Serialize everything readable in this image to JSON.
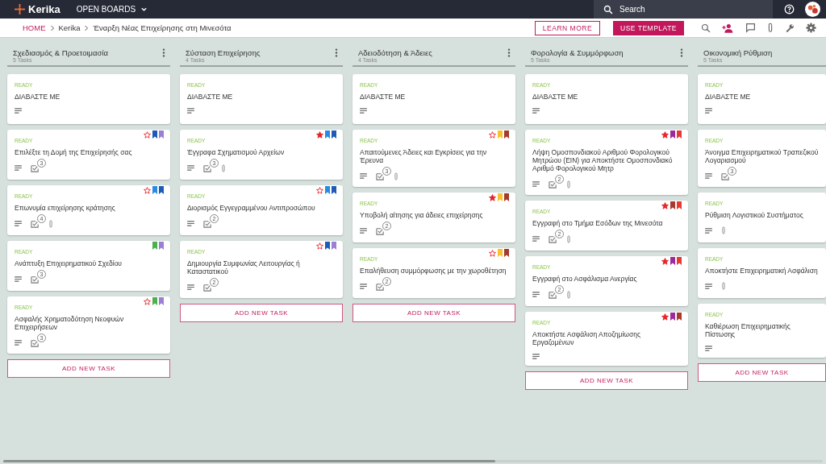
{
  "topbar": {
    "logo": "Kerika",
    "boards_menu": "OPEN BOARDS",
    "search": {
      "placeholder": "Search"
    }
  },
  "breadcrumb": [
    "HOME",
    "Kerika",
    "Έναρξη Νέας Επιχείρησης στη Μινεσότα"
  ],
  "actions": {
    "learn_more": "LEARN MORE",
    "use_template": "USE TEMPLATE"
  },
  "columns": [
    {
      "title": "Σχεδιασμός & Προετοιμασία",
      "count": "5 Tasks",
      "menu": true,
      "add_button": "ADD NEW TASK",
      "tasks": [
        {
          "status": "READY",
          "title": "ΔΙΑΒΑΣΤΕ ΜΕ",
          "attachment": false
        },
        {
          "status": "READY",
          "title": "Επιλέξτε τη Δομή της Επιχείρησής σας",
          "starred": false,
          "tags": [
            {
              "color": "#1e5bb8"
            },
            {
              "color": "#9b7fd4"
            }
          ],
          "checklist": "3",
          "attachment": false
        },
        {
          "status": "READY",
          "title": "Επωνυμία επιχείρησης κράτησης",
          "starred": false,
          "tags": [
            {
              "color": "#2a8ae0"
            },
            {
              "color": "#1e5bb8"
            }
          ],
          "checklist": "4",
          "attachment": true
        },
        {
          "status": "READY",
          "title": "Ανάπτυξη Επιχειρηματικού Σχεδίου",
          "tags": [
            {
              "color": "#4caf50"
            },
            {
              "color": "#9b7fd4"
            }
          ],
          "checklist": "3",
          "attachment": false
        },
        {
          "status": "READY",
          "title": "Ασφαλής Χρηματοδότηση Νεοφυών Επιχειρήσεων",
          "starred": false,
          "tags": [
            {
              "color": "#4caf50"
            },
            {
              "color": "#9b7fd4"
            }
          ],
          "checklist": "3",
          "attachment": false
        }
      ]
    },
    {
      "title": "Σύσταση Επιχείρησης",
      "count": "4 Tasks",
      "menu": true,
      "add_button": "ADD NEW TASK",
      "tasks": [
        {
          "status": "READY",
          "title": "ΔΙΑΒΑΣΤΕ ΜΕ",
          "attachment": false
        },
        {
          "status": "READY",
          "title": "Έγγραφα Σχηματισμού Αρχείων",
          "starred": true,
          "tags": [
            {
              "color": "#2a8ae0"
            },
            {
              "color": "#1e5bb8"
            }
          ],
          "checklist": "3",
          "attachment": true
        },
        {
          "status": "READY",
          "title": "Διορισμός Εγγεγραμμένου Αντιπροσώπου",
          "starred": false,
          "tags": [
            {
              "color": "#2a8ae0"
            },
            {
              "color": "#1e5bb8"
            }
          ],
          "checklist": "2",
          "attachment": false
        },
        {
          "status": "READY",
          "title": "Δημιουργία Συμφωνίας Λειτουργίας ή Καταστατικού",
          "starred": false,
          "tags": [
            {
              "color": "#1e5bb8"
            },
            {
              "color": "#9b7fd4"
            }
          ],
          "checklist": "2",
          "attachment": false
        }
      ]
    },
    {
      "title": "Αδειοδότηση & Άδειες",
      "count": "4 Tasks",
      "menu": true,
      "add_button": "ADD NEW TASK",
      "tasks": [
        {
          "status": "READY",
          "title": "ΔΙΑΒΑΣΤΕ ΜΕ",
          "attachment": false
        },
        {
          "status": "READY",
          "title": "Απαιτούμενες Άδειες και Εγκρίσεις για την Έρευνα",
          "starred": false,
          "tags": [
            {
              "color": "#fbc02d"
            },
            {
              "color": "#a63a2e"
            }
          ],
          "checklist": "3",
          "attachment": true
        },
        {
          "status": "READY",
          "title": "Υποβολή αίτησης για άδειες επιχείρησης",
          "starred": true,
          "tags": [
            {
              "color": "#fbc02d"
            },
            {
              "color": "#a63a2e"
            }
          ],
          "checklist": "2",
          "attachment": false
        },
        {
          "status": "READY",
          "title": "Επαλήθευση συμμόρφωσης με την χωροθέτηση",
          "starred": false,
          "tags": [
            {
              "color": "#fbc02d"
            },
            {
              "color": "#a63a2e"
            }
          ],
          "checklist": "2",
          "attachment": false
        }
      ]
    },
    {
      "title": "Φορολογία & Συμμόρφωση",
      "count": "5 Tasks",
      "menu": true,
      "add_button": "ADD NEW TASK",
      "tasks": [
        {
          "status": "READY",
          "title": "ΔΙΑΒΑΣΤΕ ΜΕ",
          "attachment": false
        },
        {
          "status": "READY",
          "title": "Λήψη Ομοσπονδιακού Αριθμού Φορολογικού Μητρώου (EIN) για Αποκτήστε Ομοσπονδιακό Αριθμό Φορολογικού Μητρ",
          "starred": true,
          "tags": [
            {
              "color": "#9c2a9c"
            },
            {
              "color": "#e53935"
            }
          ],
          "checklist": "2",
          "attachment": true
        },
        {
          "status": "READY",
          "title": "Εγγραφή στο Τμήμα Εσόδων της Μινεσότα",
          "starred": true,
          "tags": [
            {
              "color": "#a63a2e"
            },
            {
              "color": "#e53935"
            }
          ],
          "checklist": "2",
          "attachment": true
        },
        {
          "status": "READY",
          "title": "Εγγραφή στο Ασφάλισμα Ανεργίας",
          "starred": true,
          "tags": [
            {
              "color": "#9c2a9c"
            },
            {
              "color": "#e53935"
            }
          ],
          "checklist": "2",
          "attachment": true
        },
        {
          "status": "READY",
          "title": "Αποκτήστε Ασφάλιση Αποζημίωσης Εργαζομένων",
          "starred": true,
          "tags": [
            {
              "color": "#9c2a9c"
            },
            {
              "color": "#a63a2e"
            }
          ],
          "attachment": false
        }
      ]
    },
    {
      "title": "Οικονομική Ρύθμιση",
      "count": "5 Tasks",
      "menu": false,
      "add_button": "ADD NEW TASK",
      "tasks": [
        {
          "status": "READY",
          "title": "ΔΙΑΒΑΣΤΕ ΜΕ",
          "attachment": false
        },
        {
          "status": "READY",
          "title": "Άνοιγμα Επιχειρηματικού Τραπεζικού Λογαριασμού",
          "checklist": "3",
          "attachment": false
        },
        {
          "status": "READY",
          "title": "Ρύθμιση Λογιστικού Συστήματος",
          "attachment": true
        },
        {
          "status": "READY",
          "title": "Αποκτήστε Επιχειρηματική Ασφάλιση",
          "attachment": true
        },
        {
          "status": "READY",
          "title": "Καθιέρωση Επιχειρηματικής Πίστωσης",
          "attachment": false
        }
      ]
    }
  ]
}
